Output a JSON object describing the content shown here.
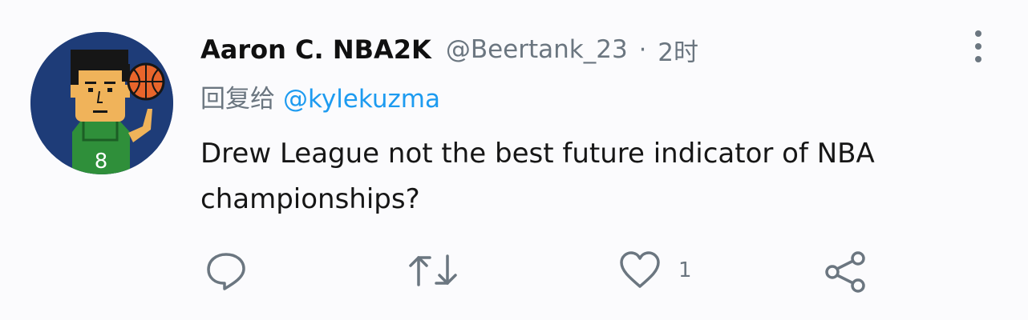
{
  "tweet": {
    "author_name": "Aaron C. NBA2K",
    "handle": "@Beertank_23",
    "separator": "·",
    "time": "2时",
    "reply_prefix": "回复给",
    "reply_handle": "@kylekuzma",
    "text": "Drew League not the best future indicator of NBA championships?",
    "avatar_jersey_number": "8"
  },
  "actions": {
    "like_count": "1"
  },
  "colors": {
    "background": "#fbfbfd",
    "link": "#1d9bf0",
    "secondary_text": "#6b7680"
  }
}
